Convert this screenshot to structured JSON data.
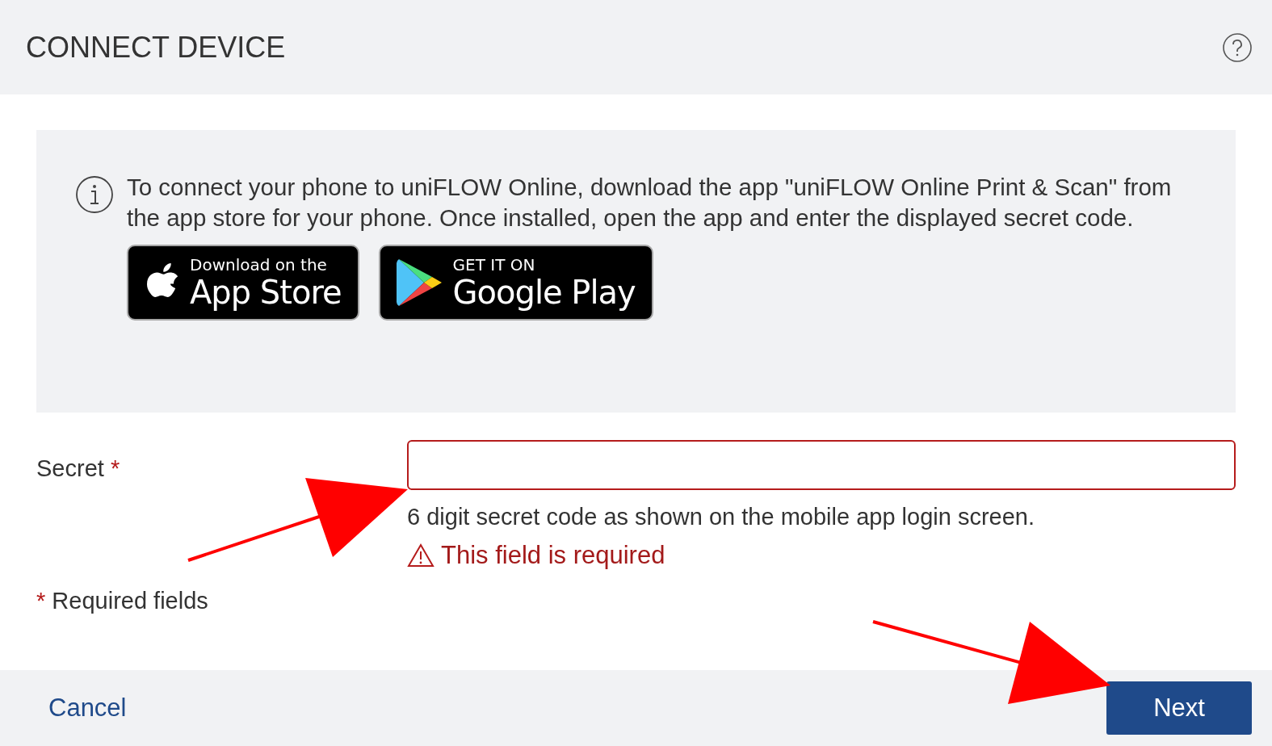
{
  "header": {
    "title": "CONNECT DEVICE"
  },
  "info": {
    "text": "To connect your phone to uniFLOW Online, download the app \"uniFLOW Online Print & Scan\" from the app store for your phone. Once installed, open the app and enter the displayed secret code.",
    "badges": [
      {
        "kind": "apple",
        "small": "Download on the",
        "large": "App Store"
      },
      {
        "kind": "google",
        "small": "GET IT ON",
        "large": "Google Play"
      }
    ]
  },
  "secret_field": {
    "label": "Secret",
    "required_mark": "*",
    "invalid": true,
    "hint": "6 digit secret code as shown on the mobile app login screen.",
    "error": "This field is required"
  },
  "required_note": {
    "mark": "*",
    "text": "Required fields"
  },
  "footer": {
    "cancel": "Cancel",
    "next": "Next"
  }
}
